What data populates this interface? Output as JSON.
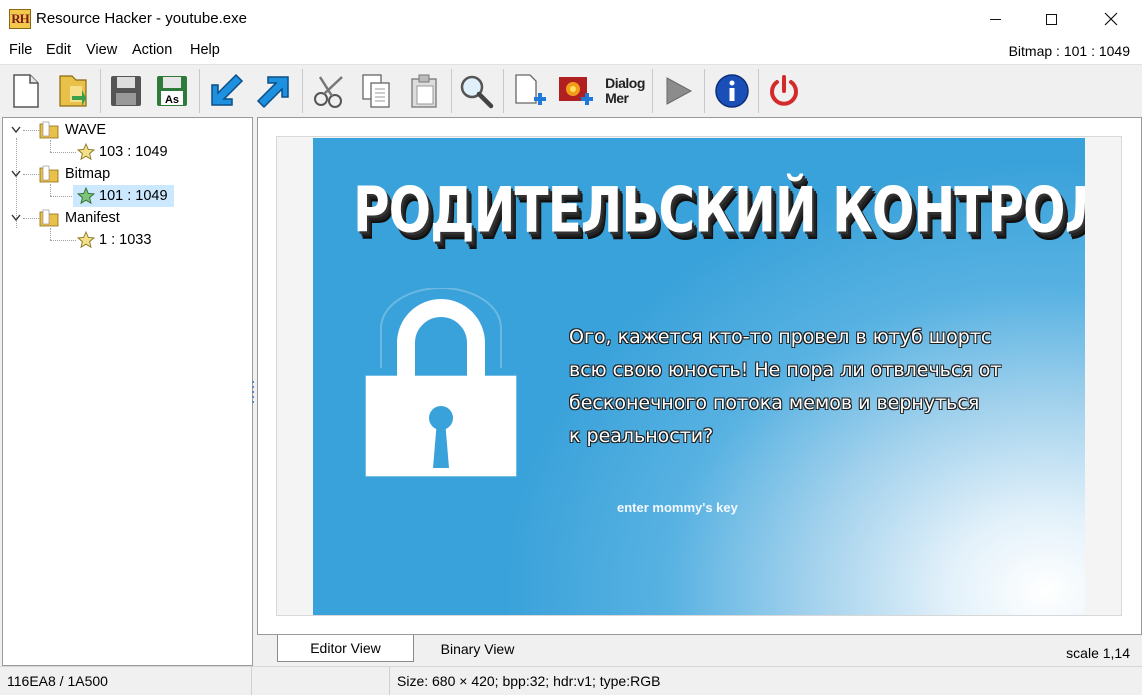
{
  "window": {
    "app_icon_text": "RH",
    "title": "Resource Hacker - youtube.exe"
  },
  "menu": {
    "items": [
      "File",
      "Edit",
      "View",
      "Action",
      "Help"
    ],
    "current_resource": "Bitmap : 101 : 1049"
  },
  "toolbar": {
    "dialog_menu_label": "Dialog\nMer"
  },
  "tree": {
    "groups": [
      {
        "label": "WAVE",
        "child": "103 : 1049"
      },
      {
        "label": "Bitmap",
        "child": "101 : 1049"
      },
      {
        "label": "Manifest",
        "child": "1 : 1033"
      }
    ]
  },
  "bitmap": {
    "title": "РОДИТЕЛЬСКИЙ КОНТРОЛЬ",
    "message": "Ого, кажется кто-то провел в ютуб шортс\nвсю свою юность! Не пора ли отвлечься от\nбесконечного потока мемов и вернуться\nк реальности?",
    "prompt": "enter mommy's key"
  },
  "tabs": {
    "editor": "Editor View",
    "binary": "Binary View",
    "scale": "scale 1,14"
  },
  "status": {
    "offset": "116EA8 / 1A500",
    "info": "Size: 680 × 420;  bpp:32;  hdr:v1;  type:RGB"
  },
  "colors": {
    "bitmap_blue": "#3aa2da",
    "selection": "#cce8ff",
    "power_red": "#d42a2a",
    "info_blue": "#1b4fb8"
  }
}
